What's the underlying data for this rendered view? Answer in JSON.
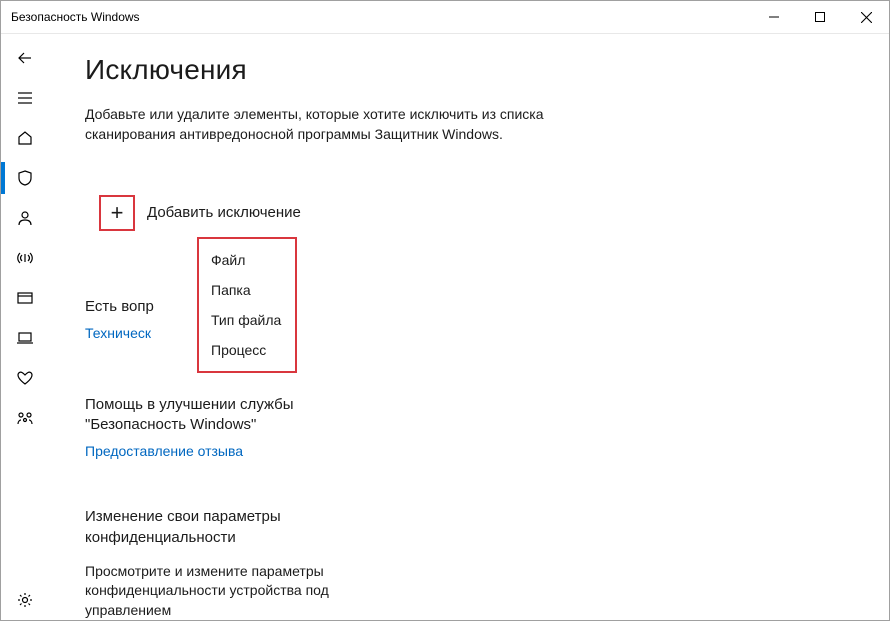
{
  "titlebar": {
    "caption": "Безопасность Windows"
  },
  "sidebar": {
    "items": [
      {
        "name": "back"
      },
      {
        "name": "menu"
      },
      {
        "name": "home"
      },
      {
        "name": "shield",
        "selected": true
      },
      {
        "name": "account"
      },
      {
        "name": "firewall"
      },
      {
        "name": "app-browser"
      },
      {
        "name": "device-security"
      },
      {
        "name": "health"
      },
      {
        "name": "family"
      }
    ],
    "settings": {
      "name": "settings"
    }
  },
  "page": {
    "title": "Исключения",
    "subtitle": "Добавьте или удалите элементы, которые хотите исключить из списка сканирования антивредоносной программы Защитник Windows."
  },
  "add": {
    "label": "Добавить исключение",
    "plus_glyph": "+",
    "menu": [
      "Файл",
      "Папка",
      "Тип файла",
      "Процесс"
    ]
  },
  "sections": {
    "questions": {
      "heading_partial": "Есть вопр",
      "link_partial": "Техническ"
    },
    "feedback": {
      "heading": "Помощь в улучшении службы \"Безопасность Windows\"",
      "link": "Предоставление отзыва"
    },
    "privacy": {
      "heading": "Изменение свои параметры конфиденциальности",
      "para": "Просмотрите и измените параметры конфиденциальности устройства под управлением"
    }
  }
}
